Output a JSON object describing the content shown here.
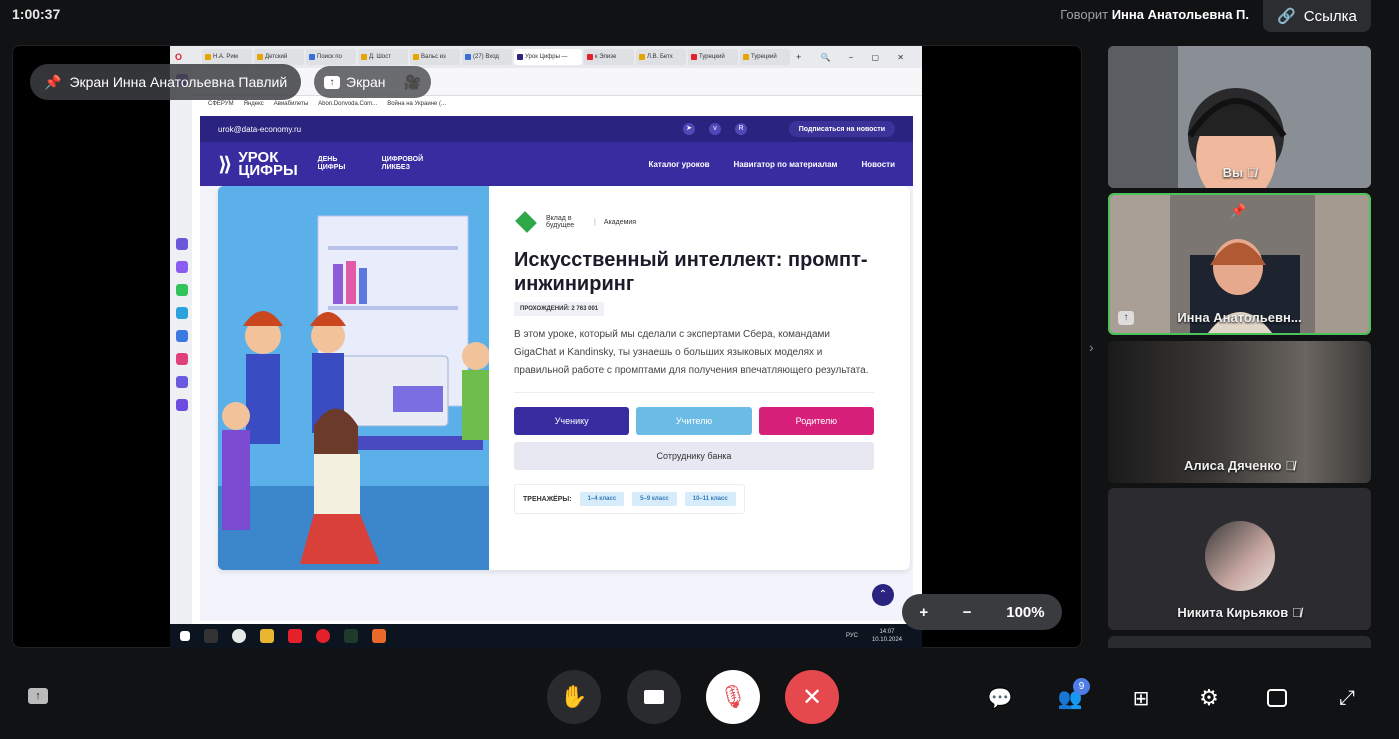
{
  "top": {
    "timer": "1:00:37",
    "speaking_label": "Говорит",
    "speaking_name": "Инна Анатольевна П.",
    "link_label": "Ссылка"
  },
  "stage": {
    "pinned_label": "Экран Инна Анатольевна Павлий",
    "screen_label": "Экран"
  },
  "browser": {
    "tabs": [
      "Н.А. Рим",
      "Детский",
      "Поиск по",
      "Д. Шост",
      "Вальс из",
      "(27) Вход",
      "Урок Цифры —",
      "к Элизе",
      "Л.В. Бетх",
      "Турецкий",
      "Турецкий"
    ],
    "bookmarks": [
      "СФЕРУМ",
      "Яндекс",
      "Авиабилеты",
      "Abon.Donvoda.Com...",
      "Война на Украине (..."
    ]
  },
  "site": {
    "email": "urok@data-economy.ru",
    "subscribe": "Подписаться на новости",
    "logo_line1": "УРОК",
    "logo_line2": "ЦИФРЫ",
    "logo_sub1": "ДЕНЬ ЦИФРЫ",
    "logo_sub2": "ЦИФРОВОЙ ЛИКБЕЗ",
    "nav": [
      "Каталог уроков",
      "Навигатор по материалам",
      "Новости"
    ],
    "partner1": "Вклад в будущее",
    "partner2": "Академия",
    "title": "Искусственный интеллект: промпт-инжиниринг",
    "passes": "ПРОХОЖДЕНИЙ: 2 763 001",
    "description": "В этом уроке, который мы сделали с экспертами Сбера, командами GigaChat и Kandinsky, ты узнаешь о больших языковых моделях и правильной работе с промптами для получения впечатляющего результата.",
    "buttons": [
      "Ученику",
      "Учителю",
      "Родителю"
    ],
    "wide_button": "Сотруднику банка",
    "trainers_label": "ТРЕНАЖЁРЫ:",
    "trainers": [
      "1–4 класс",
      "5–9 класс",
      "10–11 класс"
    ]
  },
  "taskbar": {
    "lang": "РУС",
    "time": "14:07",
    "date": "10.10.2024"
  },
  "zoom": {
    "plus": "+",
    "minus": "−",
    "value": "100%"
  },
  "participants": [
    {
      "name": "Вы",
      "muted": true
    },
    {
      "name": "Инна Анатольевн...",
      "muted": false
    },
    {
      "name": "Алиса Дяченко",
      "muted": true
    },
    {
      "name": "Никита Кирьяков",
      "muted": true
    }
  ],
  "controls": {
    "participants_count": "9"
  },
  "colors": {
    "accent_green": "#4cc25a",
    "end_call": "#e5484d",
    "site_purple": "#382ca0",
    "site_pink": "#d6207a",
    "site_blue": "#6cbbe4"
  }
}
